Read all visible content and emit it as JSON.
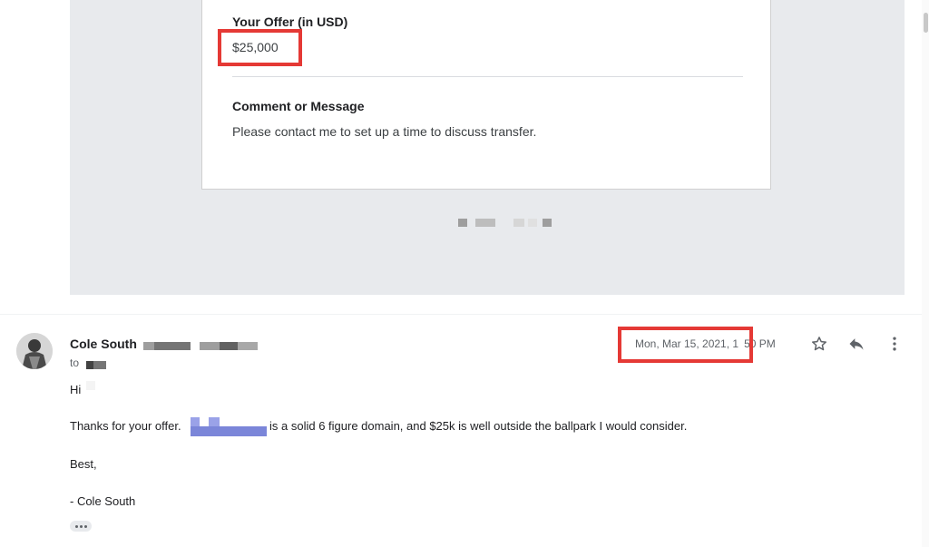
{
  "quoted_offer": {
    "offer_label": "Your Offer (in USD)",
    "offer_value": "$25,000",
    "comment_label": "Comment or Message",
    "comment_value": "Please contact me to set up a time to discuss transfer."
  },
  "email": {
    "sender_name": "Cole South",
    "to_label": "to",
    "timestamp": "Mon, Mar 15, 2021, 1",
    "timestamp_tail": "50 PM",
    "greeting": "Hi",
    "body_before": "Thanks for your offer.",
    "body_after": "is a solid 6 figure domain, and $25k is well outside the ballpark I would consider.",
    "closing": "Best,",
    "signature": "- Cole South"
  },
  "icons": {
    "star": "star-icon",
    "reply": "reply-icon",
    "more": "more-vert-icon",
    "expand": "ellipsis-icon"
  },
  "colors": {
    "highlight": "#e53935",
    "redaction_blue": "#7b86d9"
  }
}
